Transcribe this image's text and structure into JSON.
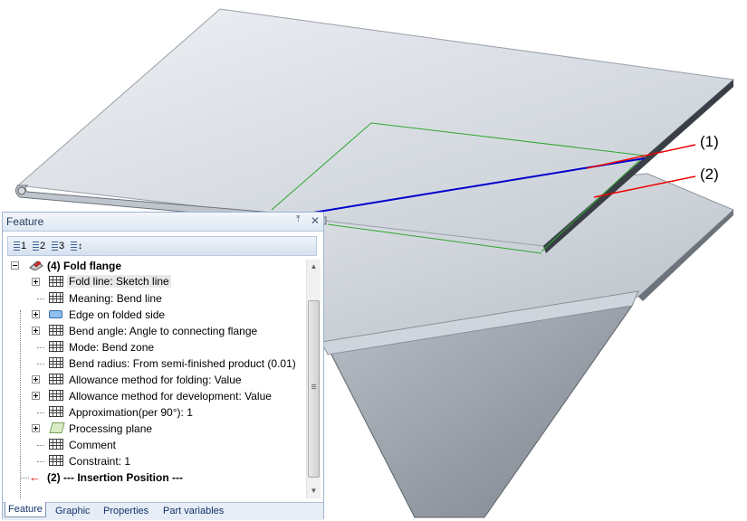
{
  "callouts": {
    "one": "(1)",
    "two": "(2)"
  },
  "panel": {
    "title": "Feature",
    "pin_glyph": "📌",
    "close_glyph": "✕",
    "toolbar": {
      "buttons": [
        {
          "name": "level-1",
          "label": "1"
        },
        {
          "name": "level-2",
          "label": "2"
        },
        {
          "name": "level-3",
          "label": "3"
        },
        {
          "name": "expand-all",
          "label": ""
        }
      ]
    },
    "tree": {
      "root": "(4) Fold flange",
      "items": [
        {
          "label": "Fold line: Sketch line",
          "icon": "table-icon",
          "expandable": true,
          "selected": true
        },
        {
          "label": "Meaning: Bend line",
          "icon": "table-icon",
          "expandable": false
        },
        {
          "label": "Edge on folded side",
          "icon": "edge-icon",
          "expandable": true
        },
        {
          "label": "Bend angle: Angle to connecting flange",
          "icon": "table-icon",
          "expandable": true
        },
        {
          "label": "Mode: Bend zone",
          "icon": "table-icon",
          "expandable": false
        },
        {
          "label": "Bend radius: From semi-finished product (0.01)",
          "icon": "table-icon",
          "expandable": false
        },
        {
          "label": "Allowance method for folding: Value",
          "icon": "table-icon",
          "expandable": true
        },
        {
          "label": "Allowance method for development: Value",
          "icon": "table-icon",
          "expandable": true
        },
        {
          "label": "Approximation(per 90°): 1",
          "icon": "table-icon",
          "expandable": false
        },
        {
          "label": "Processing plane",
          "icon": "plane-icon",
          "expandable": true
        },
        {
          "label": "Comment",
          "icon": "table-icon",
          "expandable": false
        },
        {
          "label": "Constraint: 1",
          "icon": "table-icon",
          "expandable": false
        }
      ],
      "insertion": "(2) --- Insertion Position ---"
    },
    "tabs": [
      {
        "label": "Feature",
        "active": true
      },
      {
        "label": "Graphic",
        "active": false
      },
      {
        "label": "Properties",
        "active": false
      },
      {
        "label": "Part variables",
        "active": false
      }
    ]
  },
  "colors": {
    "bend_line": "#0000cc",
    "sketch_outline": "#2ea62e",
    "callout_leader": "#ee0000",
    "panel_border": "#9fb4cf"
  }
}
